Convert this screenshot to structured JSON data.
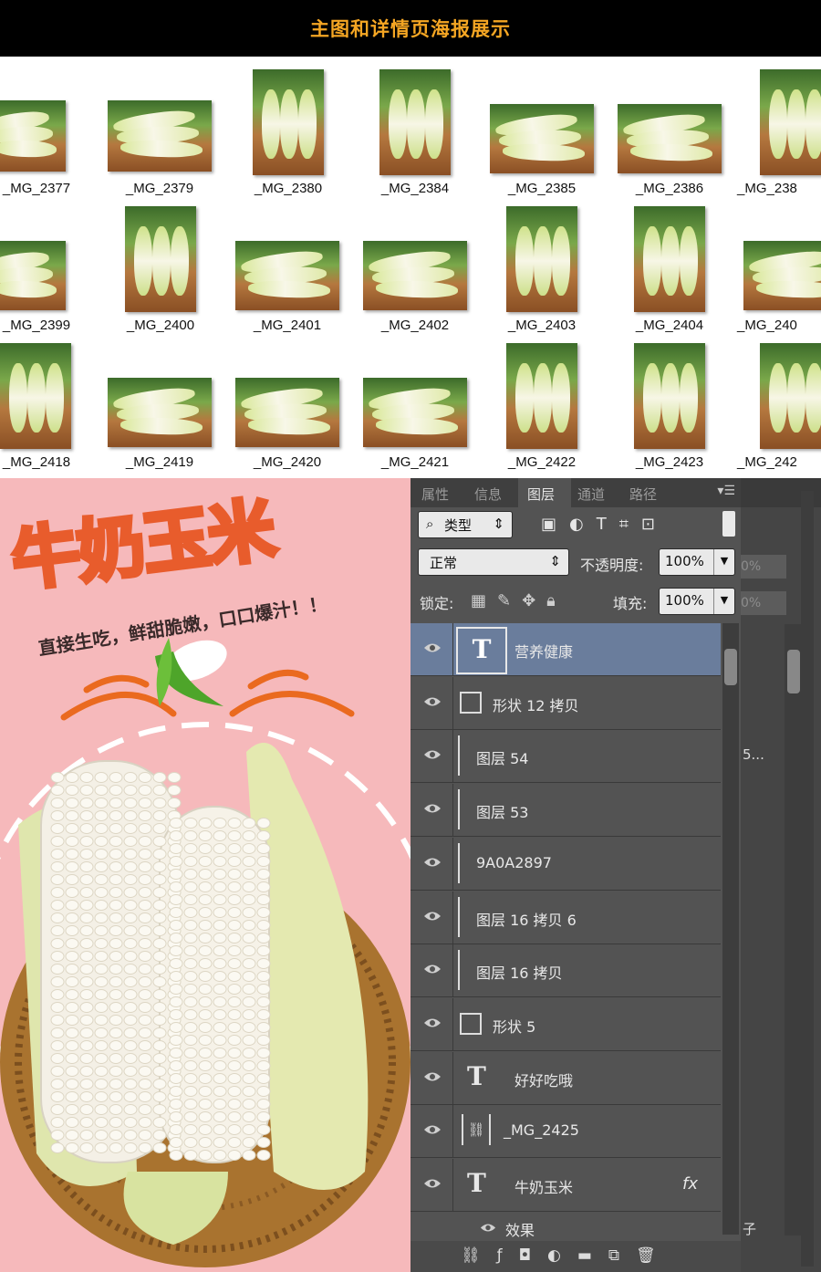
{
  "header": {
    "title": "主图和详情页海报展示"
  },
  "thumbnails": {
    "row1": [
      "_MG_2377",
      "_MG_2379",
      "_MG_2380",
      "_MG_2384",
      "_MG_2385",
      "_MG_2386",
      "_MG_238"
    ],
    "row2": [
      "_MG_2399",
      "_MG_2400",
      "_MG_2401",
      "_MG_2402",
      "_MG_2403",
      "_MG_2404",
      "_MG_240"
    ],
    "row3": [
      "_MG_2418",
      "_MG_2419",
      "_MG_2420",
      "_MG_2421",
      "_MG_2422",
      "_MG_2423",
      "_MG_242"
    ]
  },
  "poster": {
    "title": "牛奶玉米",
    "subtitle": "直接生吃，鲜甜脆嫩，口口爆汁！！"
  },
  "panel": {
    "tabs": [
      "属性",
      "信息",
      "图层",
      "通道",
      "路径"
    ],
    "active_tab": "图层",
    "filter_label": "类型",
    "blend_mode": "正常",
    "opacity_label": "不透明度:",
    "opacity_value": "100%",
    "lock_label": "锁定:",
    "fill_label": "填充:",
    "fill_value": "100%",
    "layers": [
      {
        "name": "营养健康",
        "kind": "text",
        "selected": true
      },
      {
        "name": "形状 12 拷贝",
        "kind": "shape"
      },
      {
        "name": "图层 54",
        "kind": "pixel"
      },
      {
        "name": "图层 53",
        "kind": "pixel"
      },
      {
        "name": "9A0A2897",
        "kind": "pixel"
      },
      {
        "name": "图层 16 拷贝 6",
        "kind": "pixel"
      },
      {
        "name": "图层 16 拷贝",
        "kind": "pixel"
      },
      {
        "name": "形状 5",
        "kind": "shape"
      },
      {
        "name": "好好吃哦",
        "kind": "text"
      },
      {
        "name": "_MG_2425",
        "kind": "smart"
      },
      {
        "name": "牛奶玉米",
        "kind": "text",
        "fx": "fx"
      }
    ],
    "effect_label": "效果",
    "side_fragments": {
      "pct1": "0%",
      "pct2": "0%",
      "name_frag": "5...",
      "bottom_frag": "子"
    }
  },
  "colors": {
    "header_bg": "#000000",
    "header_text": "#f5a623",
    "poster_bg": "#f6b9bb",
    "panel_bg": "#535353",
    "selected_row": "#6a7d9c"
  }
}
